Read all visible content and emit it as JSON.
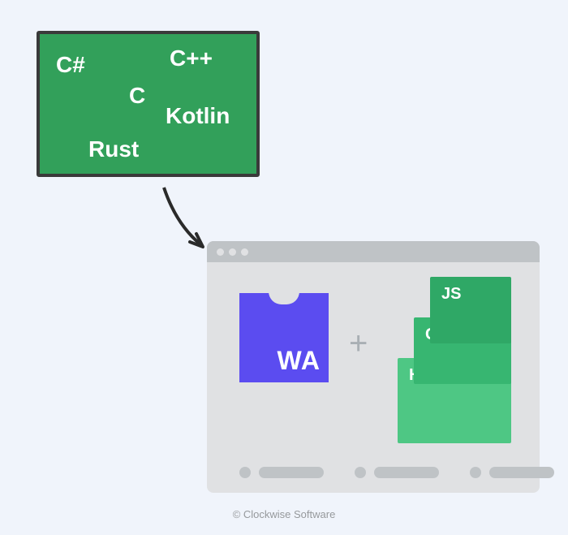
{
  "languages": {
    "csharp": "C#",
    "cpp": "C++",
    "c": "C",
    "kotlin": "Kotlin",
    "rust": "Rust"
  },
  "browser": {
    "wa_label": "WA",
    "plus": "+",
    "files": {
      "js": "JS",
      "css": "CSS",
      "html": "HTML"
    }
  },
  "copyright": "© Clockwise Software"
}
